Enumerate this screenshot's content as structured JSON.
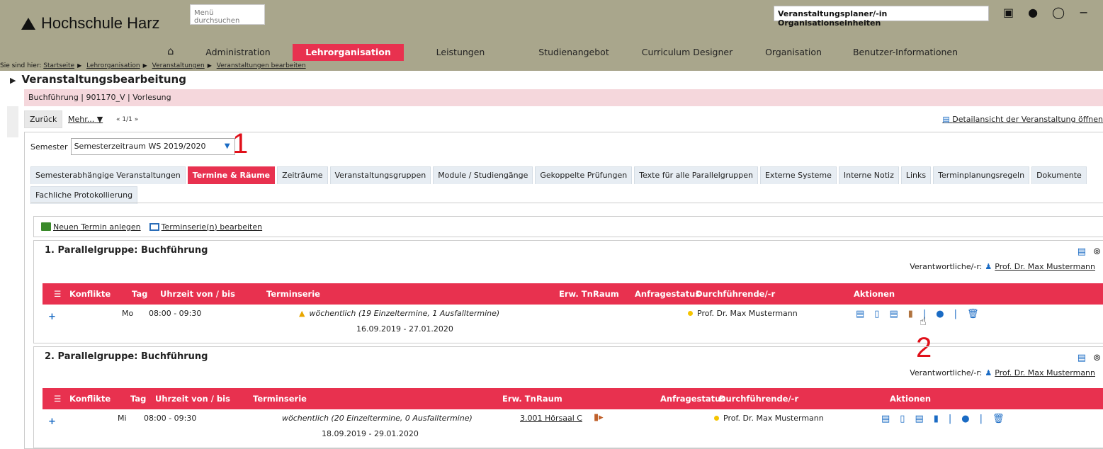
{
  "header": {
    "logo": "Hochschule Harz",
    "search_placeholder": "Menü durchsuchen",
    "role": "Veranstaltungsplaner/-in Organisationseinheiten"
  },
  "nav": {
    "items": [
      {
        "label": "Administration",
        "active": false
      },
      {
        "label": "Lehrorganisation",
        "active": true
      },
      {
        "label": "Leistungen",
        "active": false
      },
      {
        "label": "Studienangebot",
        "active": false
      },
      {
        "label": "Curriculum Designer",
        "active": false
      },
      {
        "label": "Organisation",
        "active": false
      },
      {
        "label": "Benutzer-Informationen",
        "active": false
      }
    ]
  },
  "breadcrumb": {
    "prefix": "Sie sind hier:",
    "items": [
      "Startseite",
      "Lehrorganisation",
      "Veranstaltungen",
      "Veranstaltungen bearbeiten"
    ]
  },
  "page": {
    "title": "Veranstaltungsbearbeitung",
    "subtitle": "Buchführung | 901170_V | Vorlesung",
    "back": "Zurück",
    "more": "Mehr...",
    "pager": "1/1",
    "detail_link": "Detailansicht der Veranstaltung öffnen"
  },
  "semester": {
    "label": "Semester",
    "value": "Semesterzeitraum WS 2019/2020"
  },
  "annotations": {
    "one": "1",
    "two": "2"
  },
  "tabs": [
    {
      "label": "Semesterabhängige Veranstaltungen",
      "active": false
    },
    {
      "label": "Termine & Räume",
      "active": true
    },
    {
      "label": "Zeiträume",
      "active": false
    },
    {
      "label": "Veranstaltungsgruppen",
      "active": false
    },
    {
      "label": "Module / Studiengänge",
      "active": false
    },
    {
      "label": "Gekoppelte Prüfungen",
      "active": false
    },
    {
      "label": "Texte für alle Parallelgruppen",
      "active": false
    },
    {
      "label": "Externe Systeme",
      "active": false
    },
    {
      "label": "Interne Notiz",
      "active": false
    },
    {
      "label": "Links",
      "active": false
    },
    {
      "label": "Terminplanungsregeln",
      "active": false
    },
    {
      "label": "Dokumente",
      "active": false
    },
    {
      "label": "Fachliche Protokollierung",
      "active": false
    }
  ],
  "actions": {
    "new_appointment": "Neuen Termin anlegen",
    "edit_series": "Terminserie(n) bearbeiten"
  },
  "columns": {
    "konflikte": "Konflikte",
    "tag": "Tag",
    "uhrzeit": "Uhrzeit von / bis",
    "terminserie": "Terminserie",
    "erw": "Erw. Tn.",
    "raum": "Raum",
    "anfragestatus": "Anfragestatus",
    "durchfuehrende": "Durchführende/-r",
    "aktionen": "Aktionen"
  },
  "groups": [
    {
      "title": "1. Parallelgruppe: Buchführung",
      "verant_label": "Verantwortliche/-r:",
      "verant_name": "Prof. Dr. Max Mustermann",
      "row": {
        "tag": "Mo",
        "uhrzeit": "08:00 - 09:30",
        "serie": "wöchentlich (19 Einzeltermine, 1 Ausfalltermine)",
        "range": "16.09.2019 - 27.01.2020",
        "raum": "",
        "person": "Prof. Dr. Max Mustermann"
      }
    },
    {
      "title": "2. Parallelgruppe: Buchführung",
      "verant_label": "Verantwortliche/-r:",
      "verant_name": "Prof. Dr. Max Mustermann",
      "row": {
        "tag": "Mi",
        "uhrzeit": "08:00 - 09:30",
        "serie": "wöchentlich (20 Einzeltermine, 0 Ausfalltermine)",
        "range": "18.09.2019 - 29.01.2020",
        "raum": "3.001 Hörsaal C",
        "person": "Prof. Dr. Max Mustermann"
      }
    }
  ]
}
